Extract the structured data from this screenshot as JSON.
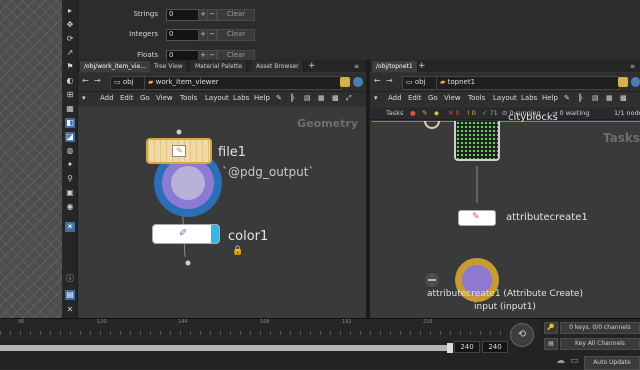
{
  "parm_panel": {
    "rows": [
      {
        "label": "Strings",
        "value": "0",
        "clear": "Clear"
      },
      {
        "label": "Integers",
        "value": "0",
        "clear": "Clear"
      },
      {
        "label": "Floats",
        "value": "0",
        "clear": "Clear"
      }
    ]
  },
  "left_pane": {
    "tabs": [
      "/obj/work_item_vie...",
      "Tree View",
      "Material Palette",
      "Asset Browser"
    ],
    "path": {
      "obj": "obj",
      "node": "work_item_viewer"
    },
    "menu": [
      "Add",
      "Edit",
      "Go",
      "View",
      "Tools",
      "Layout",
      "Labs",
      "Help"
    ],
    "context_label": "Geometry",
    "nodes": {
      "file": {
        "name": "file1",
        "subtitle": "`@pdg_output`"
      },
      "color": {
        "name": "color1"
      }
    }
  },
  "right_pane": {
    "tabs": [
      "/obj/topnet1"
    ],
    "path": {
      "obj": "obj",
      "node": "topnet1"
    },
    "menu": [
      "Add",
      "Edit",
      "Go",
      "View",
      "Tools",
      "Layout",
      "Labs",
      "Help"
    ],
    "tasks_bar": {
      "label": "Tasks",
      "errors": "0",
      "warnings": "0",
      "count": "71",
      "running": "0 running",
      "waiting": "0 waiting",
      "nodes": "1/1 node"
    },
    "context_label": "Tasks",
    "nodes": {
      "cityblocks": {
        "name": "cityblocks"
      },
      "attr": {
        "name": "attributecreate1"
      }
    },
    "footer": {
      "line1": "attributecreate1 (Attribute Create)",
      "line2": "input (input1)"
    }
  },
  "timeline": {
    "ticks": [
      "96",
      "120",
      "144",
      "168",
      "192",
      "216"
    ],
    "frame_start": "240",
    "frame_end": "240",
    "keys_label": "0 keys, 0/0 channels",
    "key_all": "Key All Channels",
    "auto_update": "Auto Update"
  }
}
